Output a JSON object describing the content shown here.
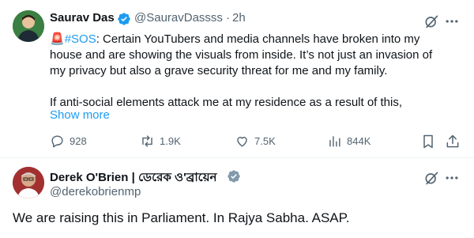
{
  "tweet": {
    "author_name": "Saurav Das",
    "handle": "@SauravDassss",
    "separator": "·",
    "time": "2h",
    "siren": "🚨",
    "hashtag": "#SOS",
    "text_1": ": Certain YouTubers and media channels have broken into my",
    "text_2": "house and are showing the visuals from inside. It’s not just an invasion of",
    "text_3": "my privacy but also a grave security threat for me and my family.",
    "text_4": "If anti-social elements attack me at my residence as a result of this,",
    "show_more": "Show more",
    "actions": {
      "replies": "928",
      "retweets": "1.9K",
      "likes": "7.5K",
      "views": "844K"
    }
  },
  "reply": {
    "author_name": "Derek O'Brien | ডেরেক ও'ব্রায়েন",
    "handle": "@derekobrienmp",
    "text": "We are raising this in Parliament. In Rajya Sabha. ASAP."
  },
  "colors": {
    "accent": "#1d9bf0",
    "muted": "#536471",
    "verified": "#1d9bf0",
    "verified_gray": "#829aab"
  },
  "icons": [
    "grok-icon",
    "more-icon",
    "reply-icon",
    "retweet-icon",
    "like-icon",
    "views-icon",
    "bookmark-icon",
    "share-icon",
    "verified-badge-icon"
  ]
}
